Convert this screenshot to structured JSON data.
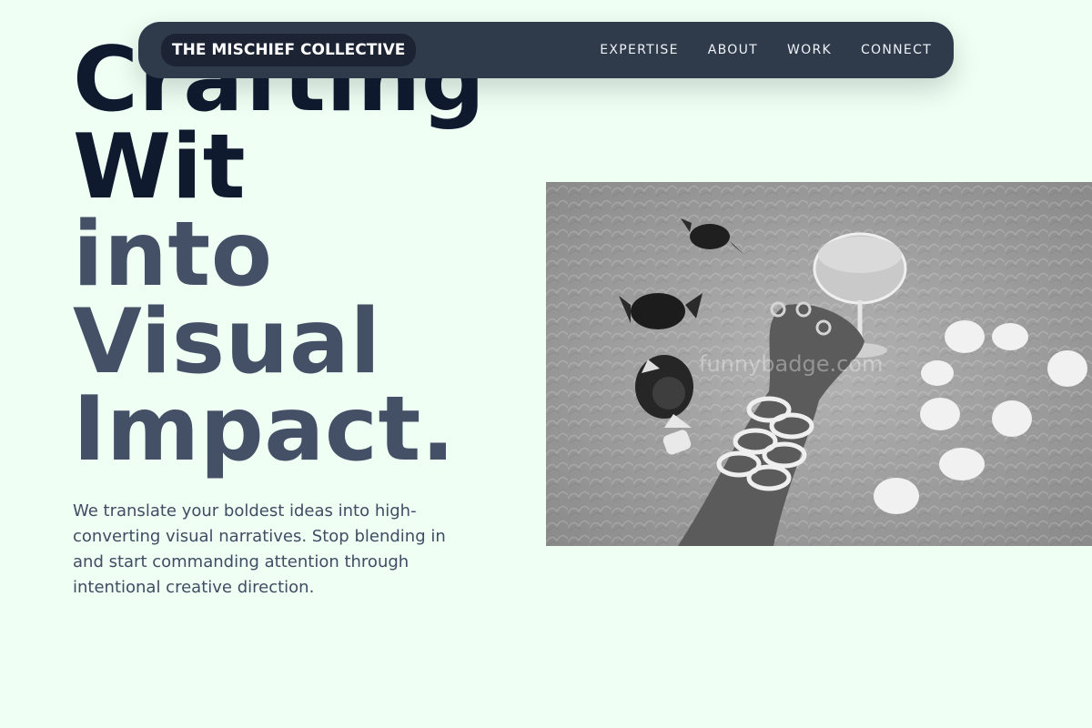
{
  "hero": {
    "title_lines": [
      "Crafting",
      "Wit",
      "into",
      "Visual",
      "Impact."
    ],
    "description": "We translate your boldest ideas into high-converting visual narratives. Stop blending in and start commanding attention through intentional creative direction."
  },
  "nav": {
    "brand": "THE MISCHIEF COLLECTIVE",
    "links": [
      "EXPERTISE",
      "ABOUT",
      "WORK",
      "CONNECT"
    ]
  },
  "photo": {
    "watermark": "funnybadge.com"
  },
  "colors": {
    "background": "#effff3",
    "nav": "#2f3a4b",
    "title_dark": "#0f1a2e",
    "title_slate": "#435066"
  }
}
